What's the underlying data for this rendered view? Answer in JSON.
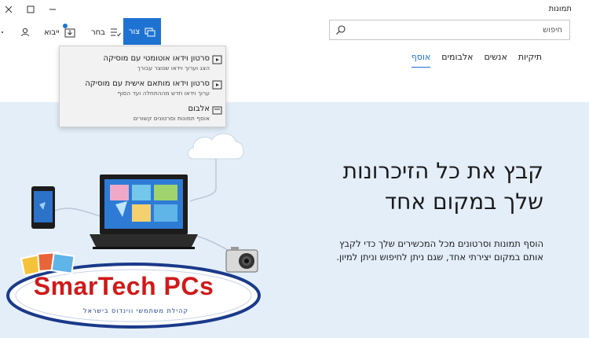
{
  "window": {
    "title": "תמונות"
  },
  "toolbar": {
    "create_label": "צור",
    "select_label": "בחר",
    "import_label": "ייבוא"
  },
  "search": {
    "placeholder": "חיפוש"
  },
  "nav": {
    "tabs": [
      {
        "label": "אוסף",
        "active": true
      },
      {
        "label": "אלבומים",
        "active": false
      },
      {
        "label": "אנשים",
        "active": false
      },
      {
        "label": "תיקיות",
        "active": false
      }
    ]
  },
  "create_menu": {
    "items": [
      {
        "title": "סרטון וידאו אוטומטי עם מוסיקה",
        "subtitle": "הצג וערוך וידאו שנוצר עבורך",
        "icon": "auto-video-icon"
      },
      {
        "title": "סרטון וידאו מותאם אישית עם מוסיקה",
        "subtitle": "ערוך וידאו חדש מההתחלה ועד הסוף",
        "icon": "custom-video-icon"
      },
      {
        "title": "אלבום",
        "subtitle": "אוסף תמונות וסרטונים קשורים",
        "icon": "album-icon"
      }
    ]
  },
  "hero": {
    "title_line1": "קבץ את כל הזיכרונות",
    "title_line2": "שלך במקום אחד",
    "desc_line1": "הוסף תמונות וסרטונים מכל המכשירים שלך כדי לקבץ",
    "desc_line2": "אותם במקום יצירתי אחד, שגם ניתן לחיפוש וניתן למיון."
  },
  "watermark": {
    "brand": "SmarTech PCs",
    "tagline": "קהילת משתמשי ווינדוס בישראל"
  },
  "colors": {
    "accent": "#1e73d2",
    "hero_bg": "#e3eef9",
    "logo_red": "#d01a1a",
    "logo_blue": "#1a3a8a"
  }
}
